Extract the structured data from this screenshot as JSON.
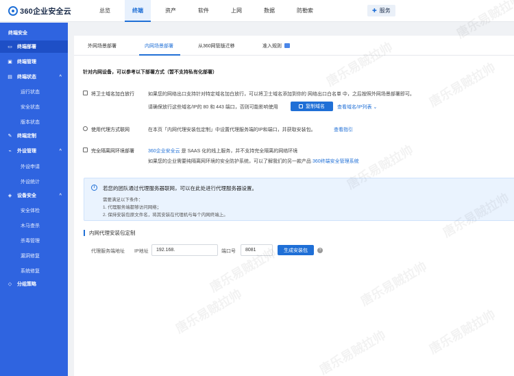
{
  "app": {
    "logo_text": "360企业安全云"
  },
  "topnav": [
    {
      "label": "总览"
    },
    {
      "label": "终端"
    },
    {
      "label": "资产"
    },
    {
      "label": "软件"
    },
    {
      "label": "上网"
    },
    {
      "label": "数据"
    },
    {
      "label": "防勒索"
    }
  ],
  "service_button": {
    "label": "服务"
  },
  "sidebar": {
    "title": "终端安全",
    "items": [
      {
        "label": "终端部署"
      },
      {
        "label": "终端管理"
      },
      {
        "label": "终端状态"
      },
      {
        "label": "运行状态"
      },
      {
        "label": "安全状态"
      },
      {
        "label": "版本状态"
      },
      {
        "label": "终端定制"
      },
      {
        "label": "外设管理"
      },
      {
        "label": "外设申请"
      },
      {
        "label": "外设统计"
      },
      {
        "label": "设备安全"
      },
      {
        "label": "安全体检"
      },
      {
        "label": "木马查杀"
      },
      {
        "label": "杀毒管理"
      },
      {
        "label": "漏洞修复"
      },
      {
        "label": "系统修复"
      },
      {
        "label": "分组策略"
      }
    ]
  },
  "tabs": [
    {
      "label": "外网场景部署"
    },
    {
      "label": "内网场景部署"
    },
    {
      "label": "从360网管版迁移"
    },
    {
      "label": "准入规则"
    }
  ],
  "content": {
    "heading": "针对内网设备，可以参考以下部署方式（暂不支持私有化部署）",
    "sec1": {
      "label": "将卫士域名加白放行",
      "line1": "如果您的网络出口支持针对特定域名加白放行，可以将卫士域名添加到你的 网络出口白名单 中，之后按照外网场景部署即可。",
      "line2": "请确保放行这些域名/IP的 80 和 443 端口，否则可能影响使用",
      "copy_button": "复制域名",
      "view_link": "查看域名/IP列表 ⌄"
    },
    "sec2": {
      "label": "使用代理方式联网",
      "text_before": "在本页「内网代理安装包定制」中设置代理服务端的IP和端口，并获取安装包。",
      "link": "查看指引"
    },
    "sec3": {
      "label": "完全隔离网环境部署",
      "line1_link": "360企业安全云",
      "line1_text": " 是 SAAS 化的线上服务，并不支持完全隔离的网络环境",
      "line2_text": "如果您的企业需要纯隔离网环境的安全防护系统，可以了解我们的另一款产品 ",
      "line2_link": "360终端安全管理系统"
    },
    "info": {
      "main": "若您的团队通过代理服务器联网，可以在此处进行代理服务器设置。",
      "sub1": "需要满足以下条件：",
      "sub2": "1. 代理服务端都够访问网络；",
      "sub3": "2. 保持安装包原文件名，将其安装在代理机与每个内网终端上。"
    },
    "proxy": {
      "title": "内网代理安装包定制",
      "label_addr": "代理服务端地址",
      "label_ip": "IP地址",
      "ip_value": "192.168.",
      "label_port": "端口号",
      "port_value": "8081",
      "gen_button": "生成安装包",
      "help": "?"
    }
  },
  "watermark_text": "唐乐易贼拉帅"
}
